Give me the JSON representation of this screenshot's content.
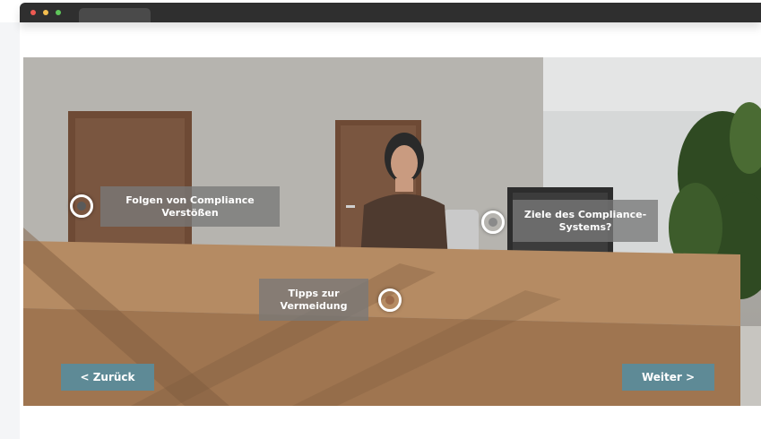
{
  "hotspots": [
    {
      "label": "Folgen von Compliance Verstößen"
    },
    {
      "label": "Ziele des Compliance-Systems?"
    },
    {
      "label": "Tipps zur Vermeidung"
    }
  ],
  "navigation": {
    "back_label": "< Zurück",
    "next_label": "Weiter >"
  },
  "colors": {
    "nav_button": "#5e8a96",
    "label_background": "#787878",
    "topbar": "#2f2f2f"
  }
}
